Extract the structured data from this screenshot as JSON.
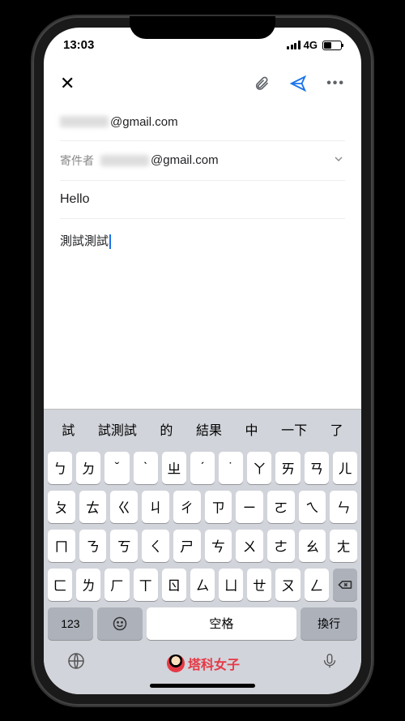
{
  "status": {
    "time": "13:03",
    "network": "4G"
  },
  "compose": {
    "to_suffix": "@gmail.com",
    "from_label": "寄件者",
    "from_suffix": "@gmail.com",
    "subject": "Hello",
    "body": "測試測試"
  },
  "keyboard": {
    "suggestions": [
      "試",
      "試測試",
      "的",
      "結果",
      "中",
      "一下",
      "了"
    ],
    "row1": [
      "ㄅ",
      "ㄉ",
      "ˇ",
      "ˋ",
      "ㄓ",
      "ˊ",
      "˙",
      "ㄚ",
      "ㄞ",
      "ㄢ",
      "ㄦ"
    ],
    "row2": [
      "ㄆ",
      "ㄊ",
      "ㄍ",
      "ㄐ",
      "ㄔ",
      "ㄗ",
      "ㄧ",
      "ㄛ",
      "ㄟ",
      "ㄣ"
    ],
    "row3": [
      "ㄇ",
      "ㄋ",
      "ㄎ",
      "ㄑ",
      "ㄕ",
      "ㄘ",
      "ㄨ",
      "ㄜ",
      "ㄠ",
      "ㄤ"
    ],
    "row4": [
      "ㄈ",
      "ㄌ",
      "ㄏ",
      "ㄒ",
      "ㄖ",
      "ㄙ",
      "ㄩ",
      "ㄝ",
      "ㄡ",
      "ㄥ"
    ],
    "num_key": "123",
    "space": "空格",
    "return": "換行",
    "brand": "塔科女子"
  }
}
